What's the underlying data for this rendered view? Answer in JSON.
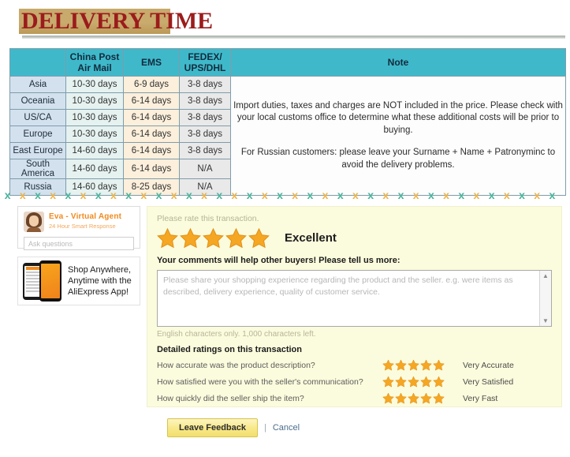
{
  "banner": {
    "title": "DELIVERY TIME",
    "band_color": "#c7a96b",
    "text_color": "#9b1c1c"
  },
  "delivery_table": {
    "header_color": "#3fb9ca",
    "columns": [
      "",
      "China Post Air Mail",
      "EMS",
      "FEDEX/ UPS/DHL",
      "Note"
    ],
    "col_china_post_line1": "China Post",
    "col_china_post_line2": "Air Mail",
    "col_ems": "EMS",
    "col_fedex_line1": "FEDEX/",
    "col_fedex_line2": "UPS/DHL",
    "col_note": "Note",
    "rows": [
      {
        "region": "Asia",
        "china_post": "10-30 days",
        "ems": "6-9 days",
        "fedex": "3-8 days"
      },
      {
        "region": "Oceania",
        "china_post": "10-30 days",
        "ems": "6-14 days",
        "fedex": "3-8 days"
      },
      {
        "region": "US/CA",
        "china_post": "10-30 days",
        "ems": "6-14 days",
        "fedex": "3-8 days"
      },
      {
        "region": "Europe",
        "china_post": "10-30 days",
        "ems": "6-14 days",
        "fedex": "3-8 days"
      },
      {
        "region": "East Europe",
        "china_post": "14-60 days",
        "ems": "6-14 days",
        "fedex": "3-8 days"
      },
      {
        "region": "South America",
        "china_post": "14-60 days",
        "ems": "6-14 days",
        "fedex": "N/A"
      },
      {
        "region": "Russia",
        "china_post": "14-60 days",
        "ems": "8-25 days",
        "fedex": "N/A"
      }
    ],
    "note_paragraph_1": "Import duties, taxes and charges are NOT included in the price. Please check with your local customs office to determine what these additional costs will be prior to buying.",
    "note_paragraph_2": "For Russian customers: please leave your Surname + Name + Patronyminc to avoid the delivery problems."
  },
  "divider": {
    "glyph": "x",
    "count": 37,
    "color_a": "#49b39b",
    "color_b": "#edb44a"
  },
  "eva": {
    "name": "Eva - Virtual Agent",
    "subtitle": "24 Hour Smart Response",
    "input_placeholder": "Ask questions"
  },
  "app_promo": {
    "line1": "Shop Anywhere,",
    "line2": "Anytime with the",
    "line3": "AliExpress App!"
  },
  "feedback": {
    "rate_prompt": "Please rate this transaction.",
    "overall_stars": 5,
    "overall_label": "Excellent",
    "comments_label": "Your comments will help other buyers! Please tell us more:",
    "comment_placeholder": "Please share your shopping experience regarding the product and the seller. e.g. were items as described, delivery experience, quality of customer service.",
    "char_info": "English characters only. 1,000 characters left.",
    "detailed_title": "Detailed ratings on this transaction",
    "detailed_rows": [
      {
        "question": "How accurate was the product description?",
        "stars": 5,
        "value": "Very Accurate"
      },
      {
        "question": "How satisfied were you with the seller's communication?",
        "stars": 5,
        "value": "Very Satisfied"
      },
      {
        "question": "How quickly did the seller ship the item?",
        "stars": 5,
        "value": "Very Fast"
      }
    ],
    "submit_label": "Leave Feedback",
    "separator": "|",
    "cancel_label": "Cancel",
    "star_color": "#f5a623"
  }
}
